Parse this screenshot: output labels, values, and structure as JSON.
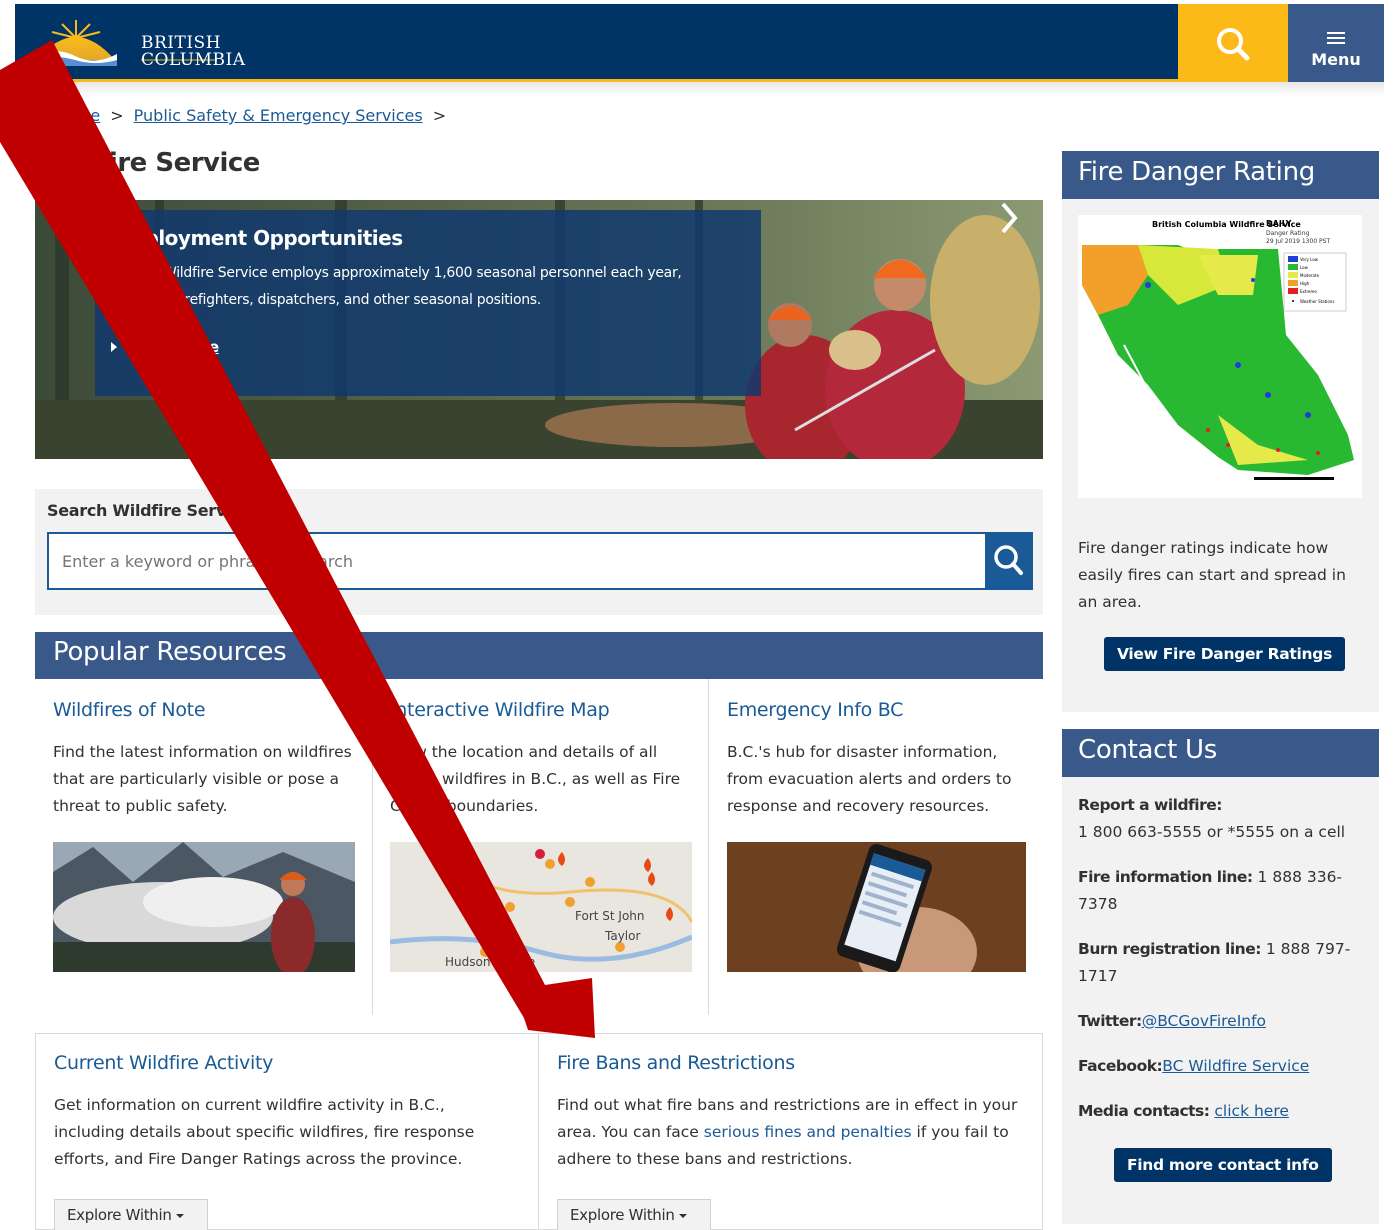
{
  "header": {
    "logo_line1": "BRITISH",
    "logo_line2": "COLUMBIA",
    "menu_label": "Menu",
    "search_icon": "search-icon",
    "menu_icon": "hamburger-icon"
  },
  "breadcrumb": {
    "items": [
      "Home",
      "Public Safety & Emergency Services"
    ],
    "separator": ">"
  },
  "page_title": "Wildfire Service",
  "hero": {
    "title": "Employment Opportunities",
    "text": "The BC Wildfire Service employs approximately 1,600 seasonal personnel each year, including firefighters, dispatchers, and other seasonal positions.",
    "link": "Learn more"
  },
  "search": {
    "heading": "Search Wildfire Service",
    "placeholder": "Enter a keyword or phrase to search"
  },
  "popular": {
    "heading": "Popular Resources",
    "items": [
      {
        "title": "Wildfires of Note",
        "text": "Find the latest information on wildfires that are particularly visible or pose a threat to public safety."
      },
      {
        "title": "Interactive Wildfire Map",
        "text": "View the location and details of all active wildfires in B.C., as well as Fire Centre boundaries."
      },
      {
        "title": "Emergency Info BC",
        "text": "B.C.'s hub for disaster information, from evacuation alerts and orders to response and recovery resources."
      }
    ],
    "map_labels": [
      "Fort St John",
      "Taylor",
      "Hudson's Hope"
    ]
  },
  "cards": [
    {
      "title": "Current Wildfire Activity",
      "text": "Get information on current wildfire activity in B.C., including details about specific wildfires, fire response efforts, and Fire Danger Ratings across the province.",
      "button": "Explore Within"
    },
    {
      "title": "Fire Bans and Restrictions",
      "text_before": "Find out what fire bans and restrictions are in effect in your area. You can face ",
      "link": "serious fines and penalties",
      "text_after": " if you fail to adhere to these bans and restrictions.",
      "button": "Explore Within"
    }
  ],
  "fire_danger": {
    "heading": "Fire Danger Rating",
    "map_title": "British Columbia Wildfire Service",
    "map_daily": "DAILY",
    "map_sub": "Danger Rating",
    "map_date": "29 Jul 2019 1300 PST",
    "legend": [
      "Very Low",
      "Low",
      "Moderate",
      "High",
      "Extreme",
      "Weather Stations"
    ],
    "text": "Fire danger ratings indicate how easily fires can start and spread in an area.",
    "button": "View Fire Danger Ratings"
  },
  "contact": {
    "heading": "Contact Us",
    "report_label": "Report a wildfire:",
    "report_value": "1 800 663-5555 or *5555 on a cell",
    "info_label": "Fire information line:",
    "info_value": " 1 888 336-7378",
    "burn_label": "Burn registration line:",
    "burn_value": " 1 888 797-1717",
    "twitter_label": "Twitter:",
    "twitter_value": "@BCGovFireInfo",
    "facebook_label": "Facebook:",
    "facebook_value": "BC Wildfire Service",
    "media_label": "Media contacts:",
    "media_value": "click here",
    "button": "Find more contact info"
  },
  "annotation": {
    "arrow_color": "#c00000"
  }
}
